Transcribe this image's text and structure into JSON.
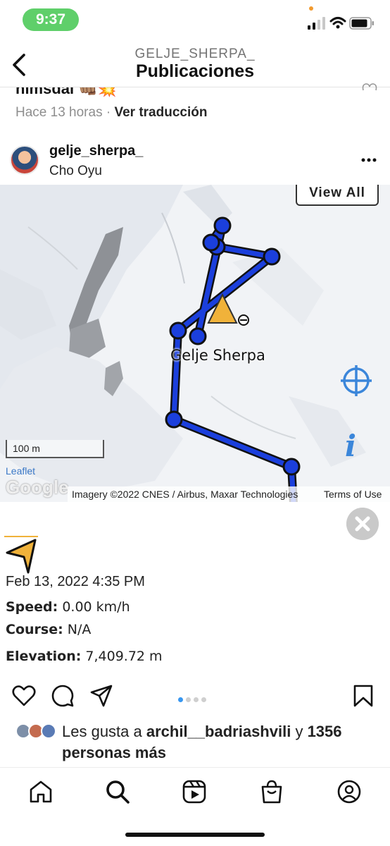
{
  "status_bar": {
    "time": "9:37"
  },
  "header": {
    "subtitle": "GELJE_SHERPA_",
    "title": "Publicaciones"
  },
  "previous_post": {
    "username": "nimsdai",
    "emoji": "👊🏽💥",
    "time_ago": "Hace 13 horas",
    "separator": "·",
    "translate_link": "Ver traducción"
  },
  "post": {
    "username": "gelje_sherpa_",
    "location": "Cho Oyu",
    "map": {
      "view_all": "View All",
      "marker_label": "Gelje Sherpa",
      "scale": "100 m",
      "leaflet": "Leaflet",
      "google": "Google",
      "imagery": "Imagery ©2022 CNES / Airbus, Maxar Technologies",
      "terms": "Terms of Use",
      "route_color": "#1b3fdc",
      "marker_color": "#f0b23a"
    },
    "info_panel": {
      "date": "Feb 13, 2022 4:35 PM",
      "speed_label": "Speed:",
      "speed_value": "0.00 km/h",
      "course_label": "Course:",
      "course_value": "N/A",
      "elevation_label": "Elevation:",
      "elevation_value": "7,409.72 m"
    },
    "carousel": {
      "count": 4,
      "active": 1
    },
    "likes": {
      "prefix": "Les gusta a",
      "user": "archil__badriashvili",
      "middle": "y",
      "count": "1356",
      "suffix": "personas más"
    }
  },
  "bottom_nav": [
    "home-icon",
    "search-icon",
    "reels-icon",
    "shop-icon",
    "profile-icon"
  ],
  "colors": {
    "accent": "#3897f0",
    "status_green": "#5fcf6a"
  }
}
